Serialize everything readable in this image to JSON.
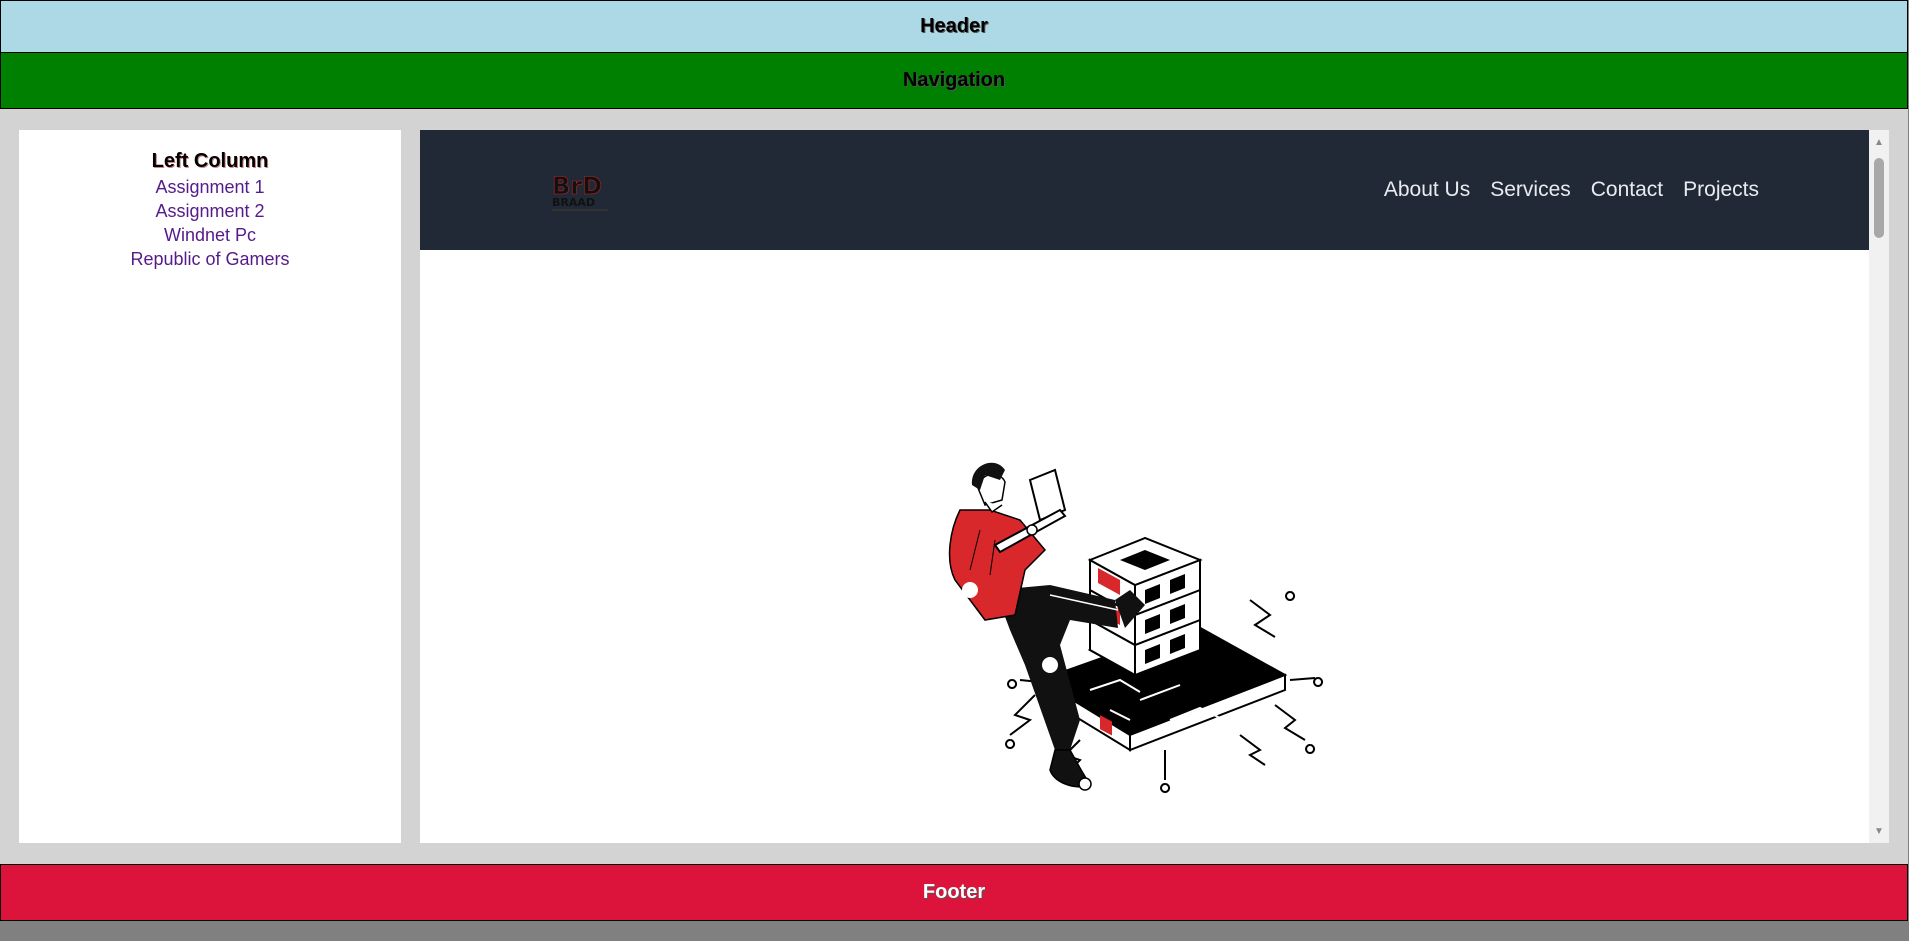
{
  "header": {
    "label": "Header"
  },
  "navigation": {
    "label": "Navigation"
  },
  "left_column": {
    "title": "Left Column",
    "links": [
      "Assignment 1",
      "Assignment 2",
      "Windnet Pc",
      "Republic of Gamers"
    ]
  },
  "embedded_site": {
    "logo_text": "BrD",
    "logo_subtext": "BRAAD",
    "nav_links": [
      "About Us",
      "Services",
      "Contact",
      "Projects"
    ],
    "hero_icon": "person-kicking-blocks-illustration"
  },
  "footer": {
    "label": "Footer"
  },
  "colors": {
    "header": "#add8e6",
    "navigation": "#008000",
    "footer": "#dc143c",
    "site_nav": "#212936",
    "accent_red": "#d9282c"
  }
}
